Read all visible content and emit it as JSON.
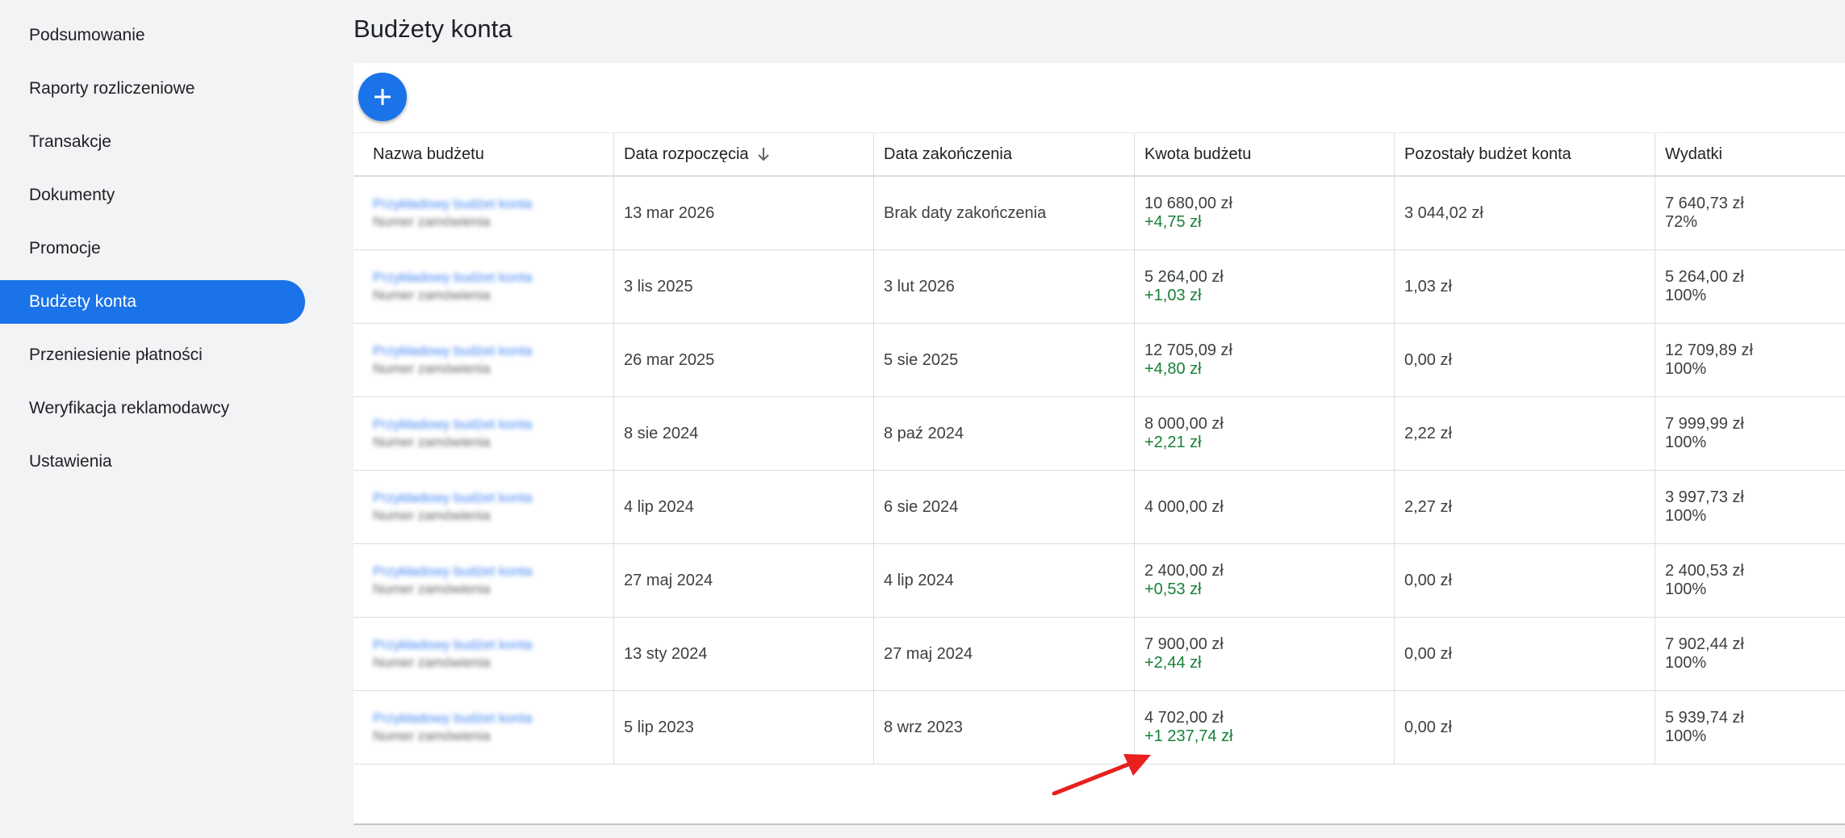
{
  "sidebar": {
    "items": [
      {
        "label": "Podsumowanie",
        "active": false
      },
      {
        "label": "Raporty rozliczeniowe",
        "active": false
      },
      {
        "label": "Transakcje",
        "active": false
      },
      {
        "label": "Dokumenty",
        "active": false
      },
      {
        "label": "Promocje",
        "active": false
      },
      {
        "label": "Budżety konta",
        "active": true
      },
      {
        "label": "Przeniesienie płatności",
        "active": false
      },
      {
        "label": "Weryfikacja reklamodawcy",
        "active": false
      },
      {
        "label": "Ustawienia",
        "active": false
      }
    ]
  },
  "page": {
    "title": "Budżety konta"
  },
  "toolbar": {
    "add_icon": "plus-icon"
  },
  "table": {
    "headers": {
      "name": "Nazwa budżetu",
      "start": "Data rozpoczęcia",
      "end": "Data zakończenia",
      "amount": "Kwota budżetu",
      "remaining": "Pozostały budżet konta",
      "spend": "Wydatki"
    },
    "sort_icon": "arrow-down-icon",
    "rows": [
      {
        "name_blur": "Przykładowy budżet konta",
        "sub_blur": "Numer zamówienia",
        "start": "13 mar 2026",
        "end": "Brak daty zakończenia",
        "amount": "10 680,00 zł",
        "adjust": "+4,75 zł",
        "remaining": "3 044,02 zł",
        "spend": "7 640,73 zł",
        "percent": "72%"
      },
      {
        "name_blur": "Przykładowy budżet konta",
        "sub_blur": "Numer zamówienia",
        "start": "3 lis 2025",
        "end": "3 lut 2026",
        "amount": "5 264,00 zł",
        "adjust": "+1,03 zł",
        "remaining": "1,03 zł",
        "spend": "5 264,00 zł",
        "percent": "100%"
      },
      {
        "name_blur": "Przykładowy budżet konta",
        "sub_blur": "Numer zamówienia",
        "start": "26 mar 2025",
        "end": "5 sie 2025",
        "amount": "12 705,09 zł",
        "adjust": "+4,80 zł",
        "remaining": "0,00 zł",
        "spend": "12 709,89 zł",
        "percent": "100%"
      },
      {
        "name_blur": "Przykładowy budżet konta",
        "sub_blur": "Numer zamówienia",
        "start": "8 sie 2024",
        "end": "8 paź 2024",
        "amount": "8 000,00 zł",
        "adjust": "+2,21 zł",
        "remaining": "2,22 zł",
        "spend": "7 999,99 zł",
        "percent": "100%"
      },
      {
        "name_blur": "Przykładowy budżet konta",
        "sub_blur": "Numer zamówienia",
        "start": "4 lip 2024",
        "end": "6 sie 2024",
        "amount": "4 000,00 zł",
        "adjust": "",
        "remaining": "2,27 zł",
        "spend": "3 997,73 zł",
        "percent": "100%"
      },
      {
        "name_blur": "Przykładowy budżet konta",
        "sub_blur": "Numer zamówienia",
        "start": "27 maj 2024",
        "end": "4 lip 2024",
        "amount": "2 400,00 zł",
        "adjust": "+0,53 zł",
        "remaining": "0,00 zł",
        "spend": "2 400,53 zł",
        "percent": "100%"
      },
      {
        "name_blur": "Przykładowy budżet konta",
        "sub_blur": "Numer zamówienia",
        "start": "13 sty 2024",
        "end": "27 maj 2024",
        "amount": "7 900,00 zł",
        "adjust": "+2,44 zł",
        "remaining": "0,00 zł",
        "spend": "7 902,44 zł",
        "percent": "100%"
      },
      {
        "name_blur": "Przykładowy budżet konta",
        "sub_blur": "Numer zamówienia",
        "start": "5 lip 2023",
        "end": "8 wrz 2023",
        "amount": "4 702,00 zł",
        "adjust": "+1 237,74 zł",
        "remaining": "0,00 zł",
        "spend": "5 939,74 zł",
        "percent": "100%"
      }
    ]
  },
  "annotation": {
    "icon": "red-arrow-icon",
    "color": "#e8201e"
  },
  "colors": {
    "accent": "#1a73e8",
    "positive": "#188038"
  }
}
